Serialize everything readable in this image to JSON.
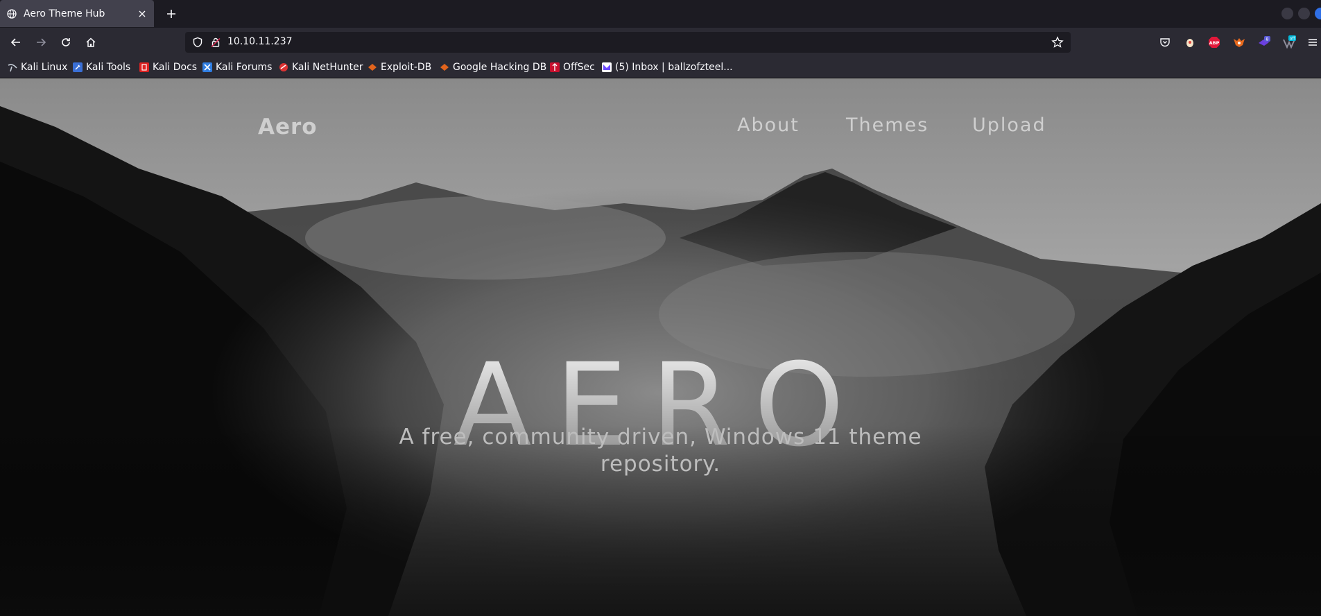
{
  "browser": {
    "tab": {
      "title": "Aero Theme Hub"
    },
    "url": "10.10.11.237",
    "bookmarks": [
      {
        "label": "Kali Linux",
        "icon": "kali-dragon-icon",
        "color": "#9ab"
      },
      {
        "label": "Kali Tools",
        "icon": "kali-tools-icon",
        "color": "#3a6fd6"
      },
      {
        "label": "Kali Docs",
        "icon": "kali-docs-icon",
        "color": "#d22"
      },
      {
        "label": "Kali Forums",
        "icon": "kali-forums-icon",
        "color": "#2f7de1"
      },
      {
        "label": "Kali NetHunter",
        "icon": "nethunter-icon",
        "color": "#d33"
      },
      {
        "label": "Exploit-DB",
        "icon": "exploit-db-icon",
        "color": "#e3641c"
      },
      {
        "label": "Google Hacking DB",
        "icon": "ghdb-icon",
        "color": "#e3641c"
      },
      {
        "label": "OffSec",
        "icon": "offsec-icon",
        "color": "#c8102e"
      },
      {
        "label": "(5) Inbox | ballzofzteel...",
        "icon": "proton-mail-icon",
        "color": "#6d4aff"
      }
    ],
    "extensions": [
      {
        "name": "pocket-icon"
      },
      {
        "name": "extension-egg-icon"
      },
      {
        "name": "adblock-icon",
        "label": "ABP"
      },
      {
        "name": "foxyproxy-icon"
      },
      {
        "name": "extension-badge-icon",
        "badge": "8"
      },
      {
        "name": "wappalyzer-icon",
        "badge": "off"
      }
    ]
  },
  "site": {
    "brand": "Aero",
    "nav": [
      "About",
      "Themes",
      "Upload"
    ],
    "hero_title": "AERO",
    "hero_subtitle": "A free, community driven, Windows 11 theme repository."
  }
}
